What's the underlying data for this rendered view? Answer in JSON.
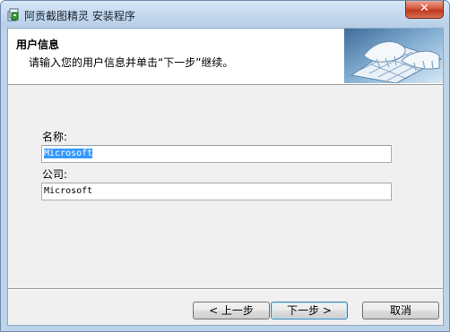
{
  "window": {
    "title": "阿贡截图精灵 安装程序",
    "close_label": "✕"
  },
  "header": {
    "title": "用户信息",
    "description": "请输入您的用户信息并单击“下一步”继续。"
  },
  "form": {
    "name_label": "名称:",
    "name_value": "Microsoft",
    "company_label": "公司:",
    "company_value": "Microsoft"
  },
  "buttons": {
    "back": "< 上一步",
    "next": "下一步 >",
    "cancel": "取消"
  },
  "colors": {
    "title_bar": "#c3d8ee",
    "selection": "#3399ff",
    "close_button": "#c0381f"
  },
  "icons": {
    "app": "installer-icon",
    "header_image": "keyboard-hands-image"
  }
}
